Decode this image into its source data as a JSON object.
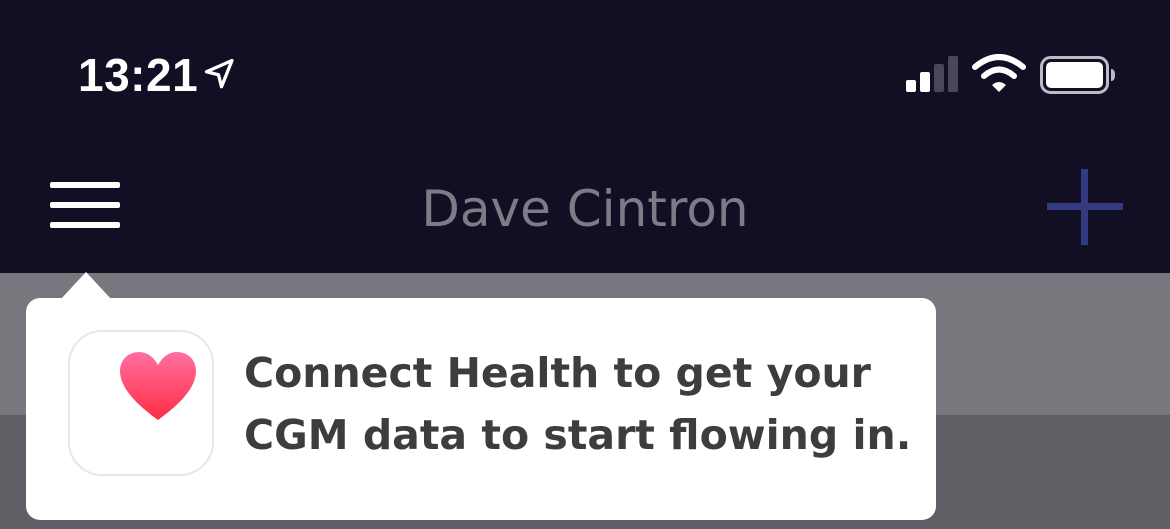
{
  "status_bar": {
    "time": "13:21",
    "icons": [
      "location-arrow-icon",
      "cellular-signal-icon",
      "wifi-icon",
      "battery-icon"
    ]
  },
  "nav": {
    "title": "Dave Cintron",
    "menu_icon": "hamburger-menu-icon",
    "add_icon": "plus-icon"
  },
  "tooltip": {
    "icon": "health-app-heart-icon",
    "message": "Connect Health to get your CGM data to start flowing in."
  },
  "colors": {
    "header_bg": "#120e24",
    "overlay_band": "#78777d",
    "overlay_lower": "#5f5f66",
    "plus_accent": "#333a80",
    "heart": "#ff3a5f"
  }
}
